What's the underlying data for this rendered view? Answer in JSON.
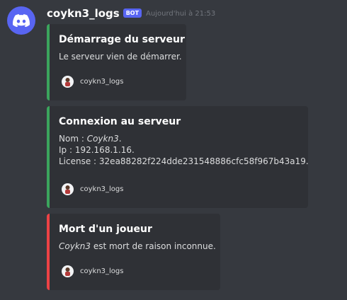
{
  "message": {
    "author": "coykn3_logs",
    "bot_badge": "BOT",
    "timestamp": "Aujourd'hui à 21:53"
  },
  "colors": {
    "success": "#3ba55d",
    "danger": "#ed4245",
    "blurple": "#5865f2"
  },
  "embeds": [
    {
      "title": "Démarrage du serveur",
      "description": "Le serveur vien de démarrer.",
      "footer": "coykn3_logs",
      "accent": "#3ba55d"
    },
    {
      "title": "Connexion au serveur",
      "nom_label": "Nom : ",
      "nom_value": "Coykn3",
      "nom_suffix": ".",
      "ip_line": "Ip : 192.168.1.16.",
      "license_line": "License : 32ea88282f224dde231548886cfc58f967b43a19.",
      "footer": "coykn3_logs",
      "accent": "#3ba55d"
    },
    {
      "title": "Mort d'un joueur",
      "player": "Coykn3",
      "death_text": " est mort de raison inconnue.",
      "footer": "coykn3_logs",
      "accent": "#ed4245"
    }
  ],
  "icons": {
    "avatar": "discord-logo-icon",
    "footer": "footer-avatar-icon"
  }
}
